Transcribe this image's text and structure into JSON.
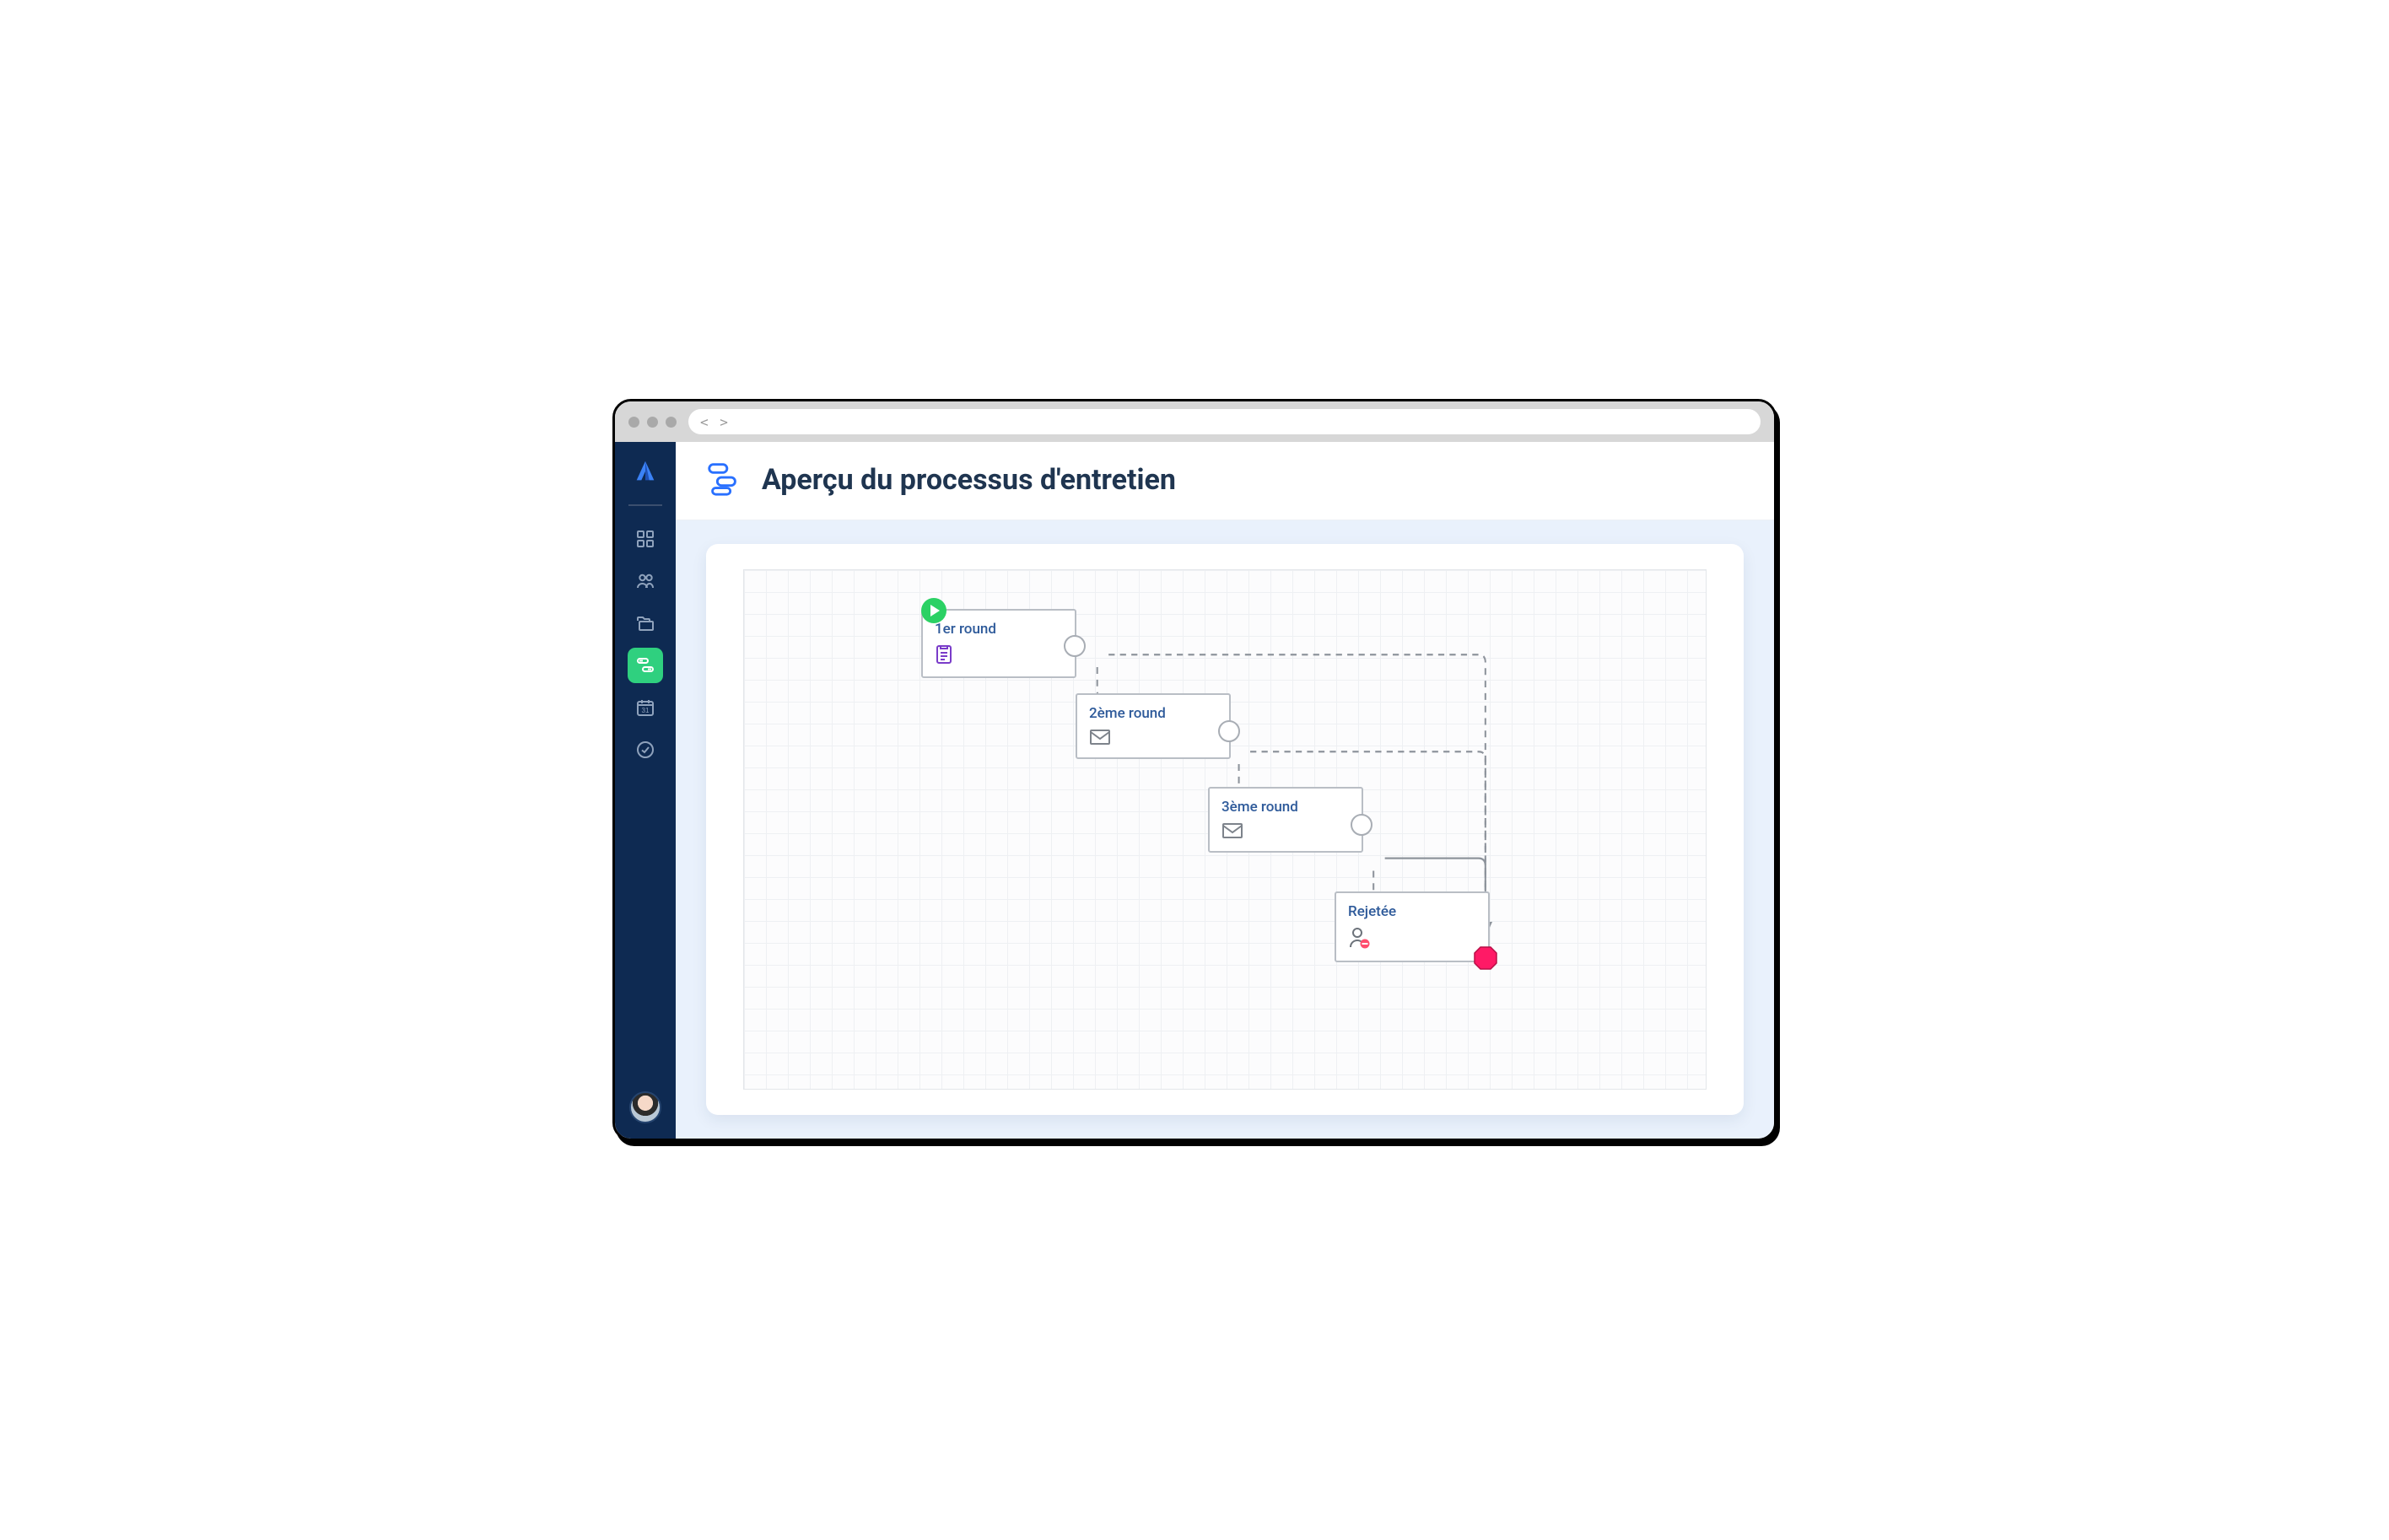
{
  "header": {
    "title": "Aperçu du processus d'entretien"
  },
  "sidebar": {
    "items": [
      {
        "name": "dashboard"
      },
      {
        "name": "people"
      },
      {
        "name": "folders"
      },
      {
        "name": "workflow",
        "active": true
      },
      {
        "name": "calendar",
        "day": "31"
      },
      {
        "name": "tasks"
      }
    ]
  },
  "diagram": {
    "nodes": {
      "n1": {
        "label": "1er round",
        "icon": "form-icon"
      },
      "n2": {
        "label": "2ème round",
        "icon": "envelope-icon"
      },
      "n3": {
        "label": "3ème round",
        "icon": "envelope-icon"
      },
      "n4": {
        "label": "Rejetée",
        "icon": "user-remove-icon"
      }
    }
  },
  "colors": {
    "sidebar_bg": "#0e2a52",
    "accent_green": "#2fd07f",
    "accent_blue": "#2970ff",
    "stop_red": "#ff1a66",
    "canvas_bg": "#e9f1fc",
    "title_text": "#1f3550",
    "node_label": "#2e5a9a"
  }
}
